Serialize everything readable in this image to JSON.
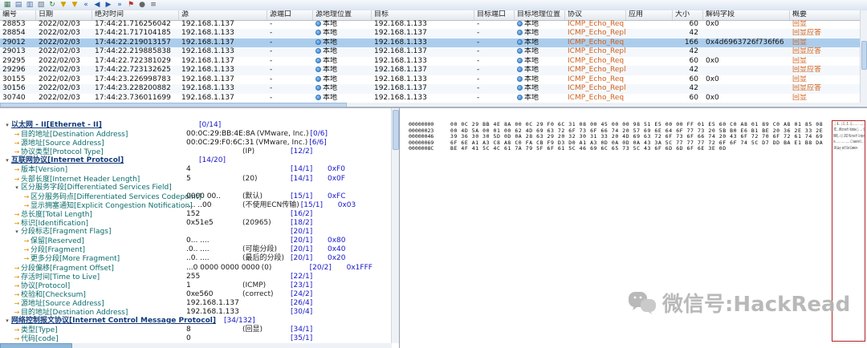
{
  "colors": {
    "protocol-text": "#d2601a",
    "selected-row-bg": "#abcdec",
    "tree-name": "#0b6b6b",
    "tree-section": "#123a7a",
    "offset-text": "#1515c8",
    "ascii-box-border": "#b22222"
  },
  "toolbar": {
    "icons": [
      {
        "name": "packet-list-icon",
        "glyph": "▦",
        "color": "#35784f"
      },
      {
        "name": "export-icon",
        "glyph": "▤",
        "color": "#4a6fa5"
      },
      {
        "name": "copy-icon",
        "glyph": "▥",
        "color": "#4a6fa5"
      },
      {
        "name": "print-icon",
        "glyph": "▧",
        "color": "#667788"
      },
      {
        "name": "refresh-icon",
        "glyph": "↻",
        "color": "#2e7d32"
      },
      {
        "name": "filter-icon",
        "glyph": "▼",
        "color": "#d2a000"
      },
      {
        "name": "filter-add-icon",
        "glyph": "▼",
        "color": "#d2a000"
      },
      {
        "name": "first-packet-icon",
        "glyph": "«",
        "color": "#2255aa"
      },
      {
        "name": "prev-packet-icon",
        "glyph": "◀",
        "color": "#2255aa"
      },
      {
        "name": "next-packet-icon",
        "glyph": "▶",
        "color": "#2255aa"
      },
      {
        "name": "last-packet-icon",
        "glyph": "»",
        "color": "#2255aa"
      },
      {
        "name": "bookmark-icon",
        "glyph": "⚑",
        "color": "#c03020"
      },
      {
        "name": "find-icon",
        "glyph": "●",
        "color": "#666666"
      },
      {
        "name": "options-icon",
        "glyph": "≡",
        "color": "#555555"
      }
    ]
  },
  "packet_table": {
    "columns": [
      {
        "label": "编号"
      },
      {
        "label": "日期"
      },
      {
        "label": "绝对时间"
      },
      {
        "label": "源"
      },
      {
        "label": "源端口"
      },
      {
        "label": "源地理位置"
      },
      {
        "label": "目标"
      },
      {
        "label": "目标端口"
      },
      {
        "label": "目标地理位置"
      },
      {
        "label": "协议"
      },
      {
        "label": "应用"
      },
      {
        "label": "大小"
      },
      {
        "label": "解码字段"
      },
      {
        "label": "概要"
      }
    ],
    "rows": [
      {
        "no": "28853",
        "date": "2022/02/03",
        "time": "17:44:21.716256042",
        "src": "192.168.1.137",
        "src_port": "-",
        "src_geo": "本地",
        "dst": "192.168.1.133",
        "dst_port": "-",
        "dst_geo": "本地",
        "protocol": "ICMP_Echo_Req",
        "app": "",
        "size": "60",
        "decoded": "0x0",
        "summary": "回显",
        "selected": false
      },
      {
        "no": "28854",
        "date": "2022/02/03",
        "time": "17:44:21.717104185",
        "src": "192.168.1.133",
        "src_port": "-",
        "src_geo": "本地",
        "dst": "192.168.1.137",
        "dst_port": "-",
        "dst_geo": "本地",
        "protocol": "ICMP_Echo_Reply",
        "app": "",
        "size": "42",
        "decoded": "",
        "summary": "回显应答",
        "selected": false
      },
      {
        "no": "29012",
        "date": "2022/02/03",
        "time": "17:44:22.219013157",
        "src": "192.168.1.137",
        "src_port": "-",
        "src_geo": "本地",
        "dst": "192.168.1.133",
        "dst_port": "-",
        "dst_geo": "本地",
        "protocol": "ICMP_Echo_Req",
        "app": "",
        "size": "166",
        "decoded": "0x4d6963726f736f66",
        "summary": "回显",
        "selected": true
      },
      {
        "no": "29013",
        "date": "2022/02/03",
        "time": "17:44:22.219885838",
        "src": "192.168.1.133",
        "src_port": "-",
        "src_geo": "本地",
        "dst": "192.168.1.137",
        "dst_port": "-",
        "dst_geo": "本地",
        "protocol": "ICMP_Echo_Reply",
        "app": "",
        "size": "42",
        "decoded": "",
        "summary": "回显应答",
        "selected": false
      },
      {
        "no": "29295",
        "date": "2022/02/03",
        "time": "17:44:22.722381029",
        "src": "192.168.1.137",
        "src_port": "-",
        "src_geo": "本地",
        "dst": "192.168.1.133",
        "dst_port": "-",
        "dst_geo": "本地",
        "protocol": "ICMP_Echo_Req",
        "app": "",
        "size": "60",
        "decoded": "0x0",
        "summary": "回显",
        "selected": false
      },
      {
        "no": "29296",
        "date": "2022/02/03",
        "time": "17:44:22.723132625",
        "src": "192.168.1.133",
        "src_port": "-",
        "src_geo": "本地",
        "dst": "192.168.1.137",
        "dst_port": "-",
        "dst_geo": "本地",
        "protocol": "ICMP_Echo_Reply",
        "app": "",
        "size": "42",
        "decoded": "",
        "summary": "回显应答",
        "selected": false
      },
      {
        "no": "30155",
        "date": "2022/02/03",
        "time": "17:44:23.226998783",
        "src": "192.168.1.137",
        "src_port": "-",
        "src_geo": "本地",
        "dst": "192.168.1.133",
        "dst_port": "-",
        "dst_geo": "本地",
        "protocol": "ICMP_Echo_Req",
        "app": "",
        "size": "60",
        "decoded": "0x0",
        "summary": "回显",
        "selected": false
      },
      {
        "no": "30156",
        "date": "2022/02/03",
        "time": "17:44:23.228200882",
        "src": "192.168.1.133",
        "src_port": "-",
        "src_geo": "本地",
        "dst": "192.168.1.137",
        "dst_port": "-",
        "dst_geo": "本地",
        "protocol": "ICMP_Echo_Reply",
        "app": "",
        "size": "42",
        "decoded": "",
        "summary": "回显应答",
        "selected": false
      },
      {
        "no": "30740",
        "date": "2022/02/03",
        "time": "17:44:23.736011699",
        "src": "192.168.1.137",
        "src_port": "-",
        "src_geo": "本地",
        "dst": "192.168.1.133",
        "dst_port": "-",
        "dst_geo": "本地",
        "protocol": "ICMP_Echo_Req",
        "app": "",
        "size": "60",
        "decoded": "0x0",
        "summary": "回显",
        "selected": false
      }
    ]
  },
  "decode_tree": {
    "rows": [
      {
        "level": 0,
        "kind": "section",
        "name": "以太网 - II[Ethernet - II]",
        "value": "",
        "note": "",
        "offset": "[0/14]",
        "mask": ""
      },
      {
        "level": 1,
        "kind": "field",
        "name": "目的地址[Destination Address]",
        "value": "00:0C:29:BB:4E:8A",
        "note": "(VMware, Inc.)",
        "offset": "[0/6]",
        "mask": ""
      },
      {
        "level": 1,
        "kind": "field",
        "name": "源地址[Source Address]",
        "value": "00:0C:29:F0:6C:31",
        "note": "(VMware, Inc.)",
        "offset": "[6/6]",
        "mask": ""
      },
      {
        "level": 1,
        "kind": "field",
        "name": "协议类型[Protocol Type]",
        "value": "",
        "note": "(IP)",
        "offset": "[12/2]",
        "mask": ""
      },
      {
        "level": 0,
        "kind": "section",
        "name": "互联网协议[Internet Protocol]",
        "value": "",
        "note": "",
        "offset": "[14/20]",
        "mask": ""
      },
      {
        "level": 1,
        "kind": "field",
        "name": "版本[Version]",
        "value": "4",
        "note": "",
        "offset": "[14/1]",
        "mask": "0xF0"
      },
      {
        "level": 1,
        "kind": "field",
        "name": "头部长度[Internet Header Length]",
        "value": "5",
        "note": "(20)",
        "offset": "[14/1]",
        "mask": "0x0F"
      },
      {
        "level": 1,
        "kind": "group",
        "name": "区分服务字段[Differentiated Services Field]",
        "value": "",
        "note": "",
        "offset": "",
        "mask": ""
      },
      {
        "level": 2,
        "kind": "field",
        "name": "区分服务码点[Differentiated Services Codepoint]",
        "value": "0000 00..",
        "note": "(默认)",
        "offset": "[15/1]",
        "mask": "0xFC"
      },
      {
        "level": 2,
        "kind": "field",
        "name": "显示拥塞通知[Explicit Congestion Notification]",
        "value": ".... ..00",
        "note": "(不使用ECN传输)",
        "offset": "[15/1]",
        "mask": "0x03"
      },
      {
        "level": 1,
        "kind": "field",
        "name": "总长度[Total Length]",
        "value": "152",
        "note": "",
        "offset": "[16/2]",
        "mask": ""
      },
      {
        "level": 1,
        "kind": "field",
        "name": "标识[Identification]",
        "value": "0x51e5",
        "note": "(20965)",
        "offset": "[18/2]",
        "mask": ""
      },
      {
        "level": 1,
        "kind": "group",
        "name": "分段标志[Fragment Flags]",
        "value": "",
        "note": "",
        "offset": "[20/1]",
        "mask": ""
      },
      {
        "level": 2,
        "kind": "field",
        "name": "保留[Reserved]",
        "value": "0... ....",
        "note": "",
        "offset": "[20/1]",
        "mask": "0x80"
      },
      {
        "level": 2,
        "kind": "field",
        "name": "分段[Fragment]",
        "value": ".0.. ....",
        "note": "(可能分段)",
        "offset": "[20/1]",
        "mask": "0x40"
      },
      {
        "level": 2,
        "kind": "field",
        "name": "更多分段[More Fragment]",
        "value": "..0. ....",
        "note": "(最后的分段)",
        "offset": "[20/1]",
        "mask": "0x20"
      },
      {
        "level": 1,
        "kind": "field",
        "name": "分段偏移[Fragment Offset]",
        "value": "...0 0000 0000 0000",
        "note": "(0)",
        "offset": "[20/2]",
        "mask": "0x1FFF"
      },
      {
        "level": 1,
        "kind": "field",
        "name": "存活时间[Time to Live]",
        "value": "255",
        "note": "",
        "offset": "[22/1]",
        "mask": ""
      },
      {
        "level": 1,
        "kind": "field",
        "name": "协议[Protocol]",
        "value": "1",
        "note": "(ICMP)",
        "offset": "[23/1]",
        "mask": ""
      },
      {
        "level": 1,
        "kind": "field",
        "name": "校验和[Checksum]",
        "value": "0xe560",
        "note": "(correct)",
        "offset": "[24/2]",
        "mask": ""
      },
      {
        "level": 1,
        "kind": "field",
        "name": "源地址[Source Address]",
        "value": "192.168.1.137",
        "note": "",
        "offset": "[26/4]",
        "mask": ""
      },
      {
        "level": 1,
        "kind": "field",
        "name": "目的地址[Destination Address]",
        "value": "192.168.1.133",
        "note": "",
        "offset": "[30/4]",
        "mask": ""
      },
      {
        "level": 0,
        "kind": "section",
        "name": "网络控制报文协议[Internet Control Message Protocol]",
        "value": "",
        "note": "",
        "offset": "[34/132]",
        "mask": ""
      },
      {
        "level": 1,
        "kind": "field",
        "name": "类型[Type]",
        "value": "8",
        "note": "(回显)",
        "offset": "[34/1]",
        "mask": ""
      },
      {
        "level": 1,
        "kind": "field",
        "name": "代码[code]",
        "value": "0",
        "note": "",
        "offset": "[35/1]",
        "mask": ""
      }
    ]
  },
  "hex_view": {
    "rows": [
      {
        "offset": "00000000",
        "bytes": "00 0C 29 BB 4E 8A 00 0C 29 F0 6C 31 08 00 45 00 00 98 51 E5 00 00 FF 01 E5 60 C0 A8 01 89 C0 A8 01 85 08"
      },
      {
        "offset": "00000023",
        "bytes": "00 4D 5A 00 01 00 62 4D 69 63 72 6F 73 6F 66 74 20 57 69 6E 64 6F 77 73 20 5B B0 E6 B1 BE 20 36 2E 33 2E"
      },
      {
        "offset": "00000046",
        "bytes": "39 36 30 30 5D 0D 0A 28 63 29 20 32 30 31 33 20 4D 69 63 72 6F 73 6F 66 74 20 43 6F 72 70 6F 72 61 74 69"
      },
      {
        "offset": "00000069",
        "bytes": "6F 6E A1 A3 C8 A8 C0 FA CB F9 D3 D0 A1 A3 0D 0A 0D 0A 43 3A 5C 77 77 77 72 6F 6F 74 5C D7 DD BA E1 B8 DA"
      },
      {
        "offset": "0000008C",
        "bytes": "BE 4F 41 5C 4C 61 7A 79 5F 6F 61 5C 46 69 6C 65 73 5C 43 6F 6D 6D 6F 6E 3E 0D"
      }
    ]
  },
  "watermark": {
    "text": "微信号:HackRead"
  }
}
